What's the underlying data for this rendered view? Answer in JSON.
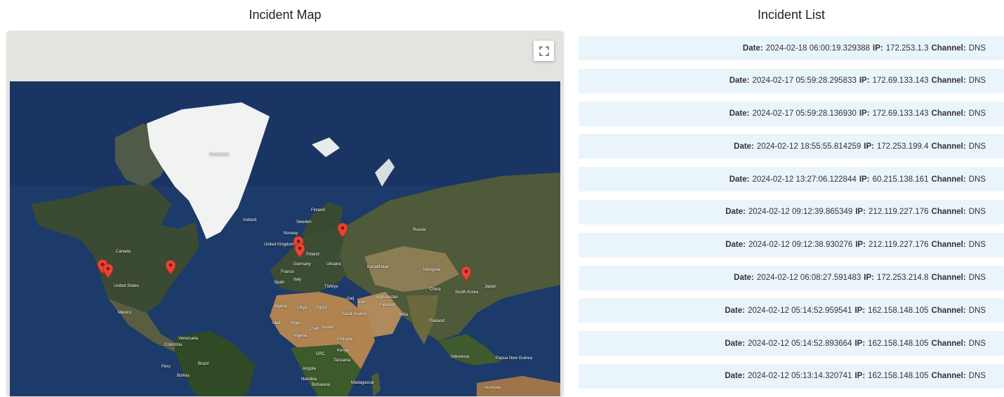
{
  "map": {
    "title": "Incident Map",
    "fullscreen_icon": "fullscreen-icon",
    "marker_icon": "map-pin-icon",
    "marker_color": "#ea4335",
    "labels": {
      "greenland": "Greenland",
      "iceland": "Iceland",
      "finland": "Finland",
      "sweden": "Sweden",
      "norway": "Norway",
      "russia": "Russia",
      "uk": "United Kingdom",
      "poland": "Poland",
      "germany": "Germany",
      "ukraine": "Ukraine",
      "france": "France",
      "italy": "Italy",
      "spain": "Spain",
      "turkiye": "Türkiye",
      "kazakhstan": "Kazakhstan",
      "mongolia": "Mongolia",
      "china": "China",
      "south_korea": "South Korea",
      "japan": "Japan",
      "canada": "Canada",
      "united_states": "United States",
      "mexico": "Mexico",
      "algeria": "Algeria",
      "libya": "Libya",
      "egypt": "Egypt",
      "iraq": "Iraq",
      "iran": "Iran",
      "afghanistan": "Afghanistan",
      "pakistan": "Pakistan",
      "saudi_arabia": "Saudi Arabia",
      "india": "India",
      "thailand": "Thailand",
      "mali": "Mali",
      "niger": "Niger",
      "chad": "Chad",
      "sudan": "Sudan",
      "nigeria": "Nigeria",
      "ethiopia": "Ethiopia",
      "drc": "DRC",
      "kenya": "Kenya",
      "tanzania": "Tanzania",
      "angola": "Angola",
      "namibia": "Namibia",
      "botswana": "Botswana",
      "madagascar": "Madagascar",
      "venezuela": "Venezuela",
      "colombia": "Colombia",
      "peru": "Peru",
      "brazil": "Brazil",
      "bolivia": "Bolivia",
      "indonesia": "Indonesia",
      "papua_new_guinea": "Papua New Guinea",
      "australia": "Australia"
    }
  },
  "list": {
    "title": "Incident List",
    "date_label": "Date:",
    "ip_label": "IP:",
    "channel_label": "Channel:",
    "items": [
      {
        "date": "2024-02-18 06:00:19.329388",
        "ip": "172.253.1.3",
        "channel": "DNS"
      },
      {
        "date": "2024-02-17 05:59:28.295833",
        "ip": "172.69.133.143",
        "channel": "DNS"
      },
      {
        "date": "2024-02-17 05:59:28.136930",
        "ip": "172.69.133.143",
        "channel": "DNS"
      },
      {
        "date": "2024-02-12 18:55:55.814259",
        "ip": "172.253.199.4",
        "channel": "DNS"
      },
      {
        "date": "2024-02-12 13:27:06.122844",
        "ip": "60.215.138.161",
        "channel": "DNS"
      },
      {
        "date": "2024-02-12 09:12:39.865349",
        "ip": "212.119.227.176",
        "channel": "DNS"
      },
      {
        "date": "2024-02-12 09:12:38.930276",
        "ip": "212.119.227.176",
        "channel": "DNS"
      },
      {
        "date": "2024-02-12 06:08:27.591483",
        "ip": "172.253.214.8",
        "channel": "DNS"
      },
      {
        "date": "2024-02-12 05:14:52.959541",
        "ip": "162.158.148.105",
        "channel": "DNS"
      },
      {
        "date": "2024-02-12 05:14:52.893664",
        "ip": "162.158.148.105",
        "channel": "DNS"
      },
      {
        "date": "2024-02-12 05:13:14.320741",
        "ip": "162.158.148.105",
        "channel": "DNS"
      }
    ]
  }
}
